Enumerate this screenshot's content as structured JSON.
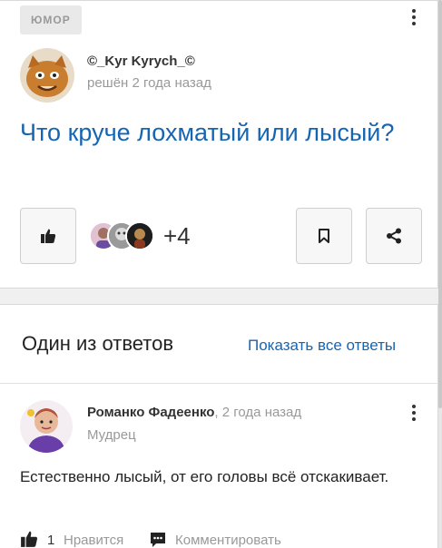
{
  "question": {
    "category": "ЮМОР",
    "author": {
      "name": "©_Kyr Kyrych_©",
      "meta": "решён 2 года назад"
    },
    "title": "Что круче лохматый или лысый?",
    "voters_more": "+4"
  },
  "answers": {
    "section_title": "Один из ответов",
    "show_all_label": "Показать все ответы",
    "answer": {
      "author": "Романко Фадеенко",
      "separator": ",",
      "time": " 2 года назад",
      "rank": "Мудрец",
      "text": "Естественно лысый, от его головы всё отскакивает.",
      "likes": "1",
      "like_label": "Нравится",
      "comment_label": "Комментировать"
    }
  },
  "colors": {
    "link": "#1565b4",
    "muted": "#999999",
    "text": "#222222"
  }
}
